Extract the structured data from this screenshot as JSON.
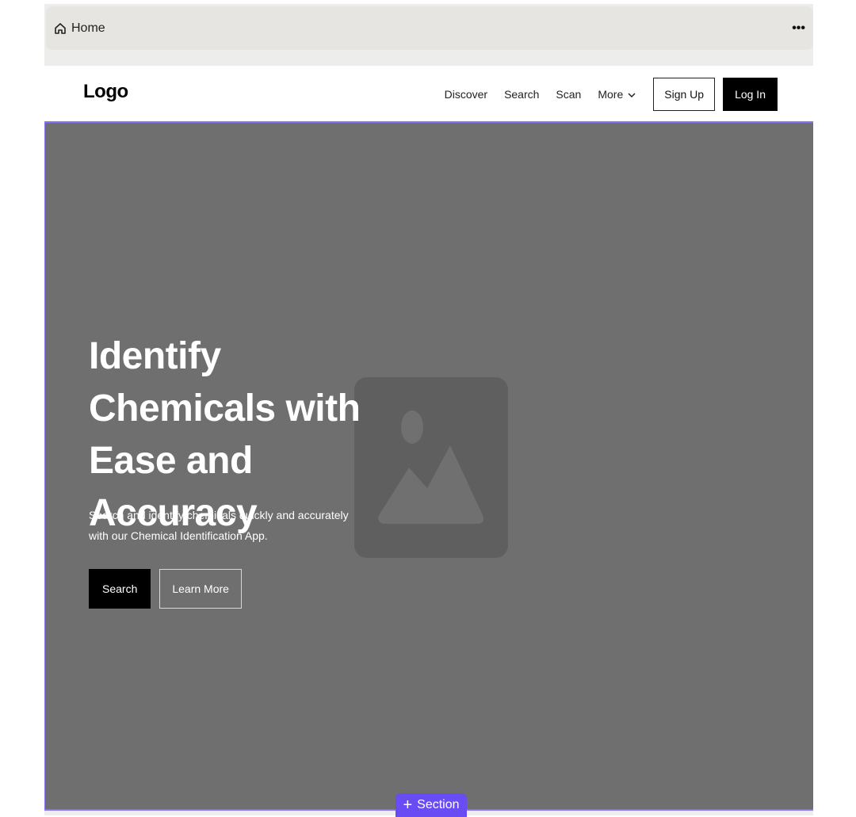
{
  "breadcrumb": {
    "home_label": "Home",
    "home_icon": "home-icon",
    "menu_icon": "more-horizontal-icon",
    "menu_label": "•••"
  },
  "navbar": {
    "logo": "Logo",
    "links": [
      {
        "label": "Discover"
      },
      {
        "label": "Search"
      },
      {
        "label": "Scan"
      },
      {
        "label": "More",
        "icon": "chevron-down-icon"
      }
    ],
    "signup_label": "Sign Up",
    "login_label": "Log In"
  },
  "hero": {
    "title": "Identify Chemicals with Ease and Accuracy",
    "subtitle": "Search and identify chemicals quickly and accurately with our Chemical Identification App.",
    "primary_button": "Search",
    "secondary_button": "Learn More",
    "image_icon": "image-placeholder-icon"
  },
  "editor": {
    "add_section_label": "Section",
    "add_section_icon": "plus-icon",
    "accent_color": "#6a4cf5"
  },
  "colors": {
    "hero_background": "#6f6f6f",
    "selection_outline": "#8a72f0"
  }
}
